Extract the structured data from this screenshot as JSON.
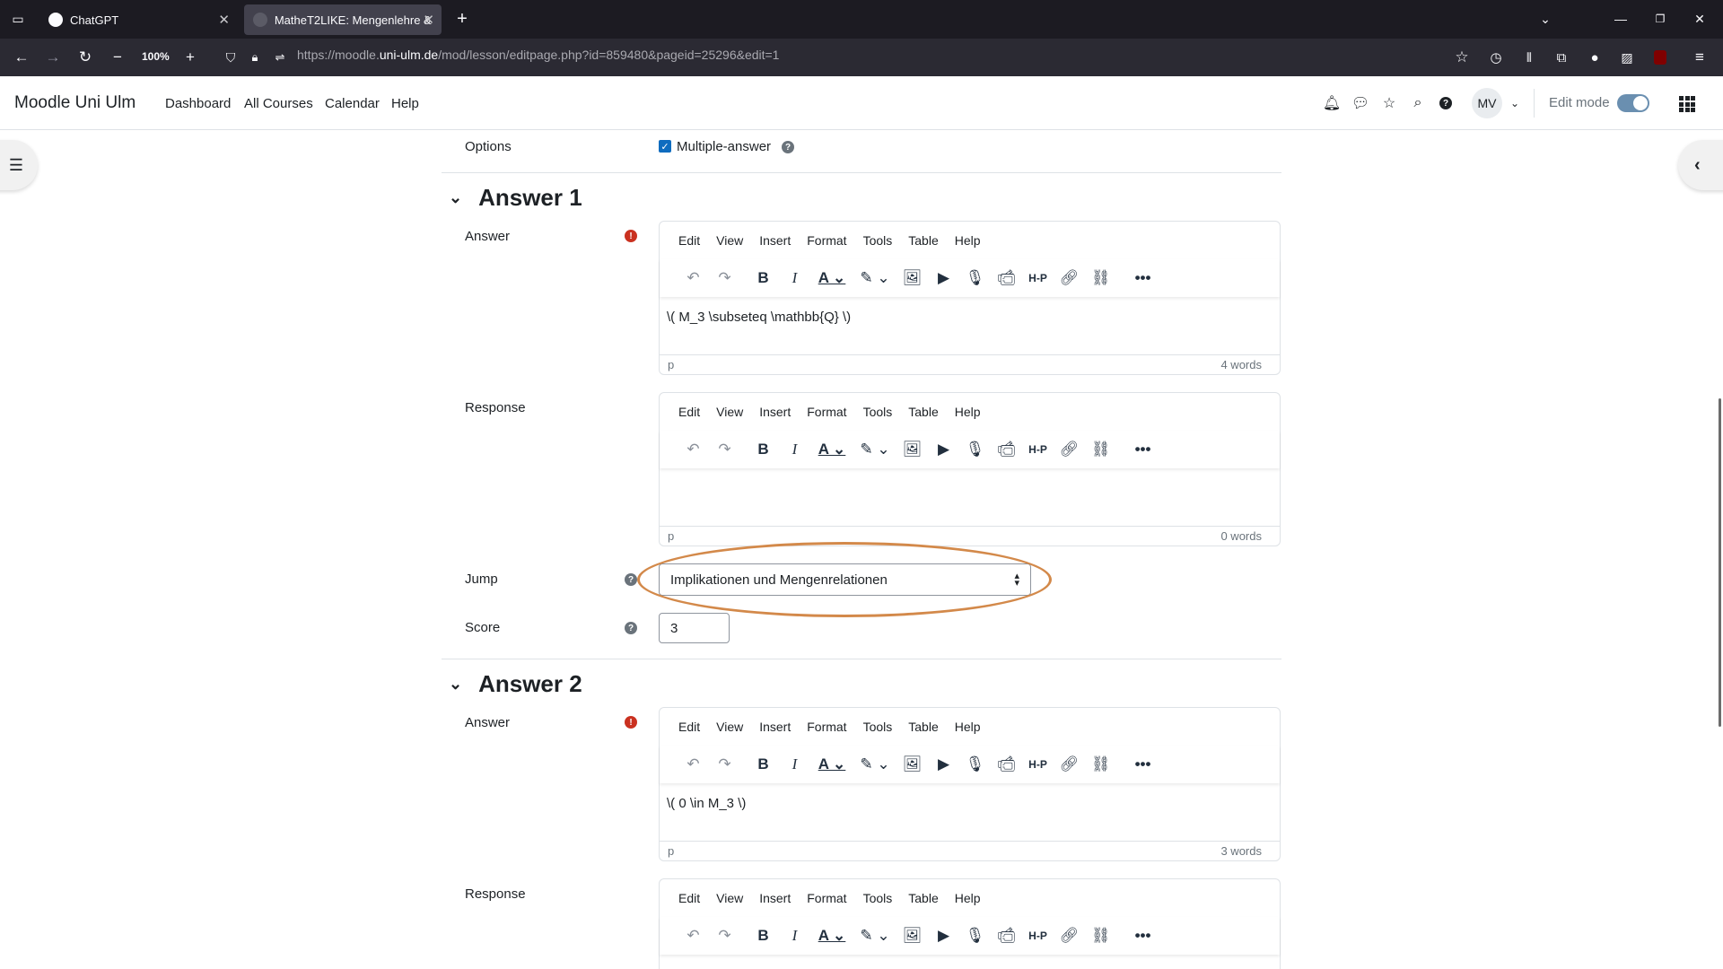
{
  "browser": {
    "tabs": [
      {
        "title": "ChatGPT"
      },
      {
        "title": "MatheT2LIKE: Mengenlehre & A"
      }
    ],
    "zoom": "100%",
    "url_prefix": "https://moodle.",
    "url_domain": "uni-ulm.de",
    "url_path": "/mod/lesson/editpage.php?id=859480&pageid=25296&edit=1"
  },
  "header": {
    "brand": "Moodle Uni Ulm",
    "nav": [
      "Dashboard",
      "All Courses",
      "Calendar",
      "Help"
    ],
    "avatar": "MV",
    "edit_mode_label": "Edit mode"
  },
  "form": {
    "options_label": "Options",
    "multiple_answer_label": "Multiple-answer",
    "editor_menu": [
      "Edit",
      "View",
      "Insert",
      "Format",
      "Tools",
      "Table",
      "Help"
    ],
    "answer1": {
      "heading": "Answer 1",
      "answer_label": "Answer",
      "answer_text": "\\( M_3 \\subseteq \\mathbb{Q} \\)",
      "answer_path": "p",
      "answer_words": "4 words",
      "response_label": "Response",
      "response_text": "",
      "response_path": "p",
      "response_words": "0 words",
      "jump_label": "Jump",
      "jump_value": "Implikationen und Mengenrelationen",
      "score_label": "Score",
      "score_value": "3"
    },
    "answer2": {
      "heading": "Answer 2",
      "answer_label": "Answer",
      "answer_text": "\\( 0 \\in M_3 \\)",
      "answer_path": "p",
      "answer_words": "3 words",
      "response_label": "Response"
    }
  },
  "colors": {
    "highlight_oval": "#d3894a",
    "required_icon": "#ca3120",
    "checkbox": "#0f6cbf"
  }
}
